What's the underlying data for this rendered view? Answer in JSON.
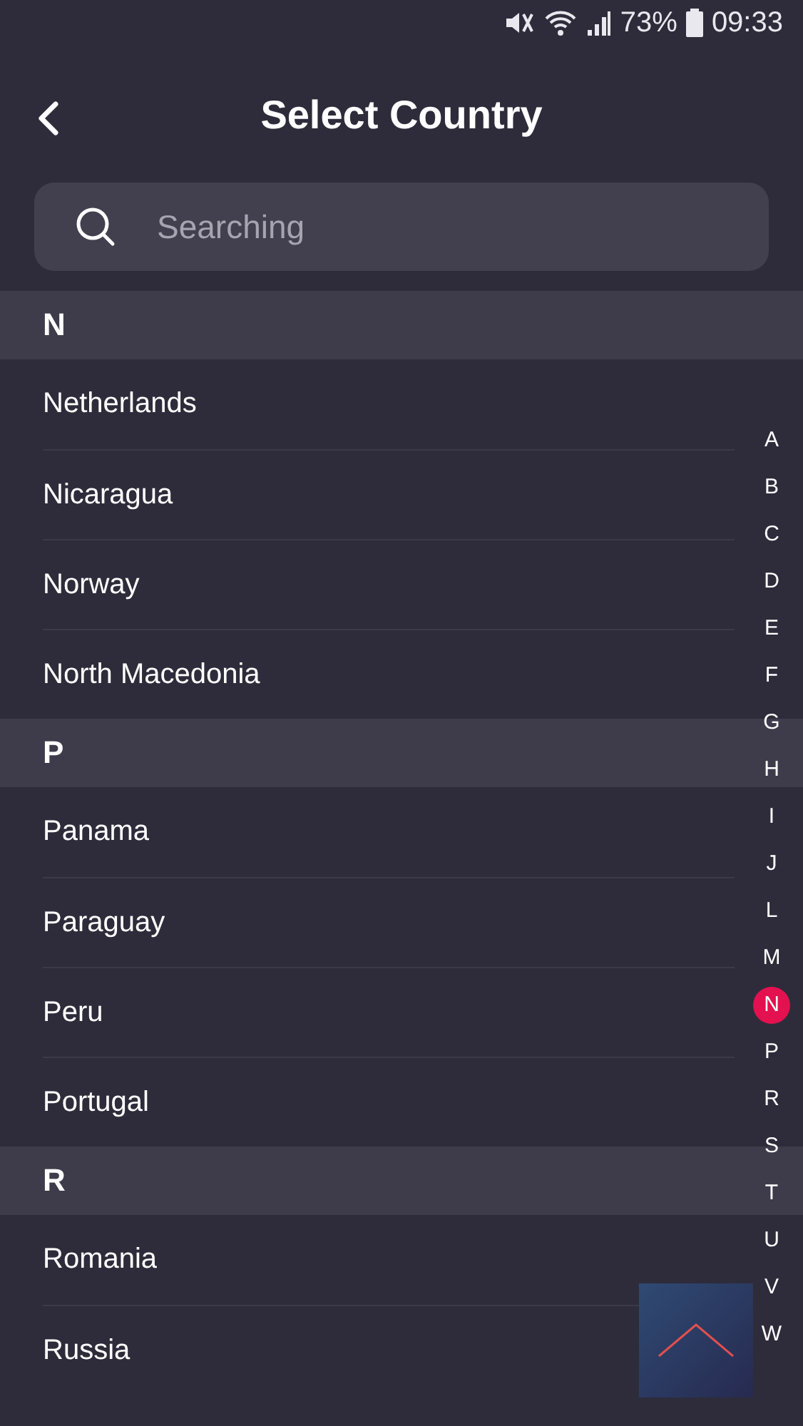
{
  "status_bar": {
    "battery": "73%",
    "time": "09:33"
  },
  "header": {
    "title": "Select Country"
  },
  "search": {
    "placeholder": "Searching"
  },
  "sections": [
    {
      "letter": "N",
      "countries": [
        "Netherlands",
        "Nicaragua",
        "Norway",
        "North Macedonia"
      ]
    },
    {
      "letter": "P",
      "countries": [
        "Panama",
        "Paraguay",
        "Peru",
        "Portugal"
      ]
    },
    {
      "letter": "R",
      "countries": [
        "Romania",
        "Russia"
      ]
    }
  ],
  "index": [
    {
      "letter": "A",
      "selected": false
    },
    {
      "letter": "B",
      "selected": false
    },
    {
      "letter": "C",
      "selected": false
    },
    {
      "letter": "D",
      "selected": false
    },
    {
      "letter": "E",
      "selected": false
    },
    {
      "letter": "F",
      "selected": false
    },
    {
      "letter": "G",
      "selected": false
    },
    {
      "letter": "H",
      "selected": false
    },
    {
      "letter": "I",
      "selected": false
    },
    {
      "letter": "J",
      "selected": false
    },
    {
      "letter": "L",
      "selected": false
    },
    {
      "letter": "M",
      "selected": false
    },
    {
      "letter": "N",
      "selected": true
    },
    {
      "letter": "P",
      "selected": false
    },
    {
      "letter": "R",
      "selected": false
    },
    {
      "letter": "S",
      "selected": false
    },
    {
      "letter": "T",
      "selected": false
    },
    {
      "letter": "U",
      "selected": false
    },
    {
      "letter": "V",
      "selected": false
    },
    {
      "letter": "W",
      "selected": false
    }
  ]
}
